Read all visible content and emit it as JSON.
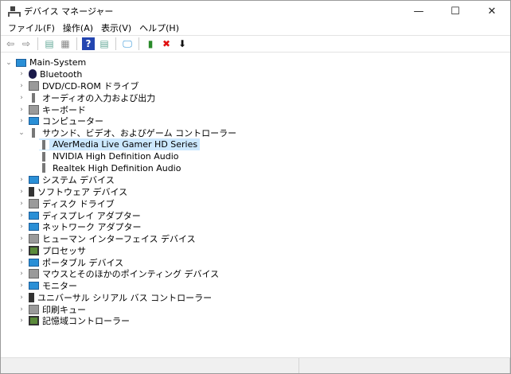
{
  "window": {
    "title": "デバイス マネージャー",
    "minimize": "—",
    "maximize": "☐",
    "close": "✕"
  },
  "menu": [
    "ファイル(F)",
    "操作(A)",
    "表示(V)",
    "ヘルプ(H)"
  ],
  "toolbar": [
    {
      "name": "back-icon",
      "glyph": "⇦",
      "color": "#777"
    },
    {
      "name": "forward-icon",
      "glyph": "⇨",
      "color": "#777"
    },
    {
      "name": "show-hide-console-tree-icon",
      "glyph": "▤",
      "color": "#6a9"
    },
    {
      "name": "properties-icon",
      "glyph": "▦",
      "color": "#888"
    },
    {
      "name": "help-icon",
      "glyph": "?",
      "color": "#fff",
      "bg": "#2345b0"
    },
    {
      "name": "action-pane-icon",
      "glyph": "▤",
      "color": "#6a9"
    },
    {
      "name": "scan-hardware-icon",
      "glyph": "🖵",
      "color": "#2a8fd6"
    },
    {
      "name": "update-driver-icon",
      "glyph": "▮",
      "color": "#2a8a2a"
    },
    {
      "name": "uninstall-icon",
      "glyph": "✖",
      "color": "#e01010"
    },
    {
      "name": "disable-device-icon",
      "glyph": "⬇",
      "color": "#111"
    }
  ],
  "tree": {
    "root": "Main-System",
    "categories": [
      {
        "label": "Bluetooth",
        "icon": "bluetooth",
        "expanded": false
      },
      {
        "label": "DVD/CD-ROM ドライブ",
        "icon": "dvd",
        "expanded": false
      },
      {
        "label": "オーディオの入力および出力",
        "icon": "speaker",
        "expanded": false
      },
      {
        "label": "キーボード",
        "icon": "keyboard",
        "expanded": false
      },
      {
        "label": "コンピューター",
        "icon": "computer",
        "expanded": false
      },
      {
        "label": "サウンド、ビデオ、およびゲーム コントローラー",
        "icon": "speaker",
        "expanded": true,
        "children": [
          {
            "label": "AVerMedia Live Gamer HD Series",
            "selected": true
          },
          {
            "label": "NVIDIA High Definition Audio",
            "selected": false
          },
          {
            "label": "Realtek High Definition Audio",
            "selected": false
          }
        ]
      },
      {
        "label": "システム デバイス",
        "icon": "monitor",
        "expanded": false
      },
      {
        "label": "ソフトウェア デバイス",
        "icon": "software",
        "expanded": false
      },
      {
        "label": "ディスク ドライブ",
        "icon": "disk",
        "expanded": false
      },
      {
        "label": "ディスプレイ アダプター",
        "icon": "monitor",
        "expanded": false
      },
      {
        "label": "ネットワーク アダプター",
        "icon": "monitor",
        "expanded": false
      },
      {
        "label": "ヒューマン インターフェイス デバイス",
        "icon": "gray",
        "expanded": false
      },
      {
        "label": "プロセッサ",
        "icon": "chip",
        "expanded": false
      },
      {
        "label": "ポータブル デバイス",
        "icon": "monitor",
        "expanded": false
      },
      {
        "label": "マウスとそのほかのポインティング デバイス",
        "icon": "gray",
        "expanded": false
      },
      {
        "label": "モニター",
        "icon": "monitor",
        "expanded": false
      },
      {
        "label": "ユニバーサル シリアル バス コントローラー",
        "icon": "software",
        "expanded": false
      },
      {
        "label": "印刷キュー",
        "icon": "gray",
        "expanded": false
      },
      {
        "label": "記憶域コントローラー",
        "icon": "chip",
        "expanded": false
      }
    ]
  }
}
